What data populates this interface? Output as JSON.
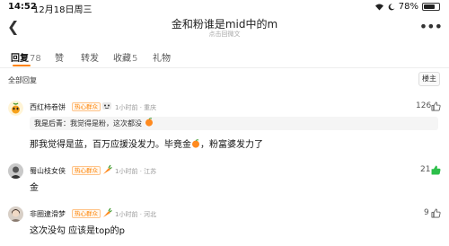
{
  "status_bar": {
    "time": "14:52",
    "date": "12月18日周三",
    "battery": "78%",
    "battery_level": 0.78
  },
  "nav": {
    "title": "金和粉谁是mid中的m",
    "subtitle": "点击回微文"
  },
  "tabs": [
    {
      "label": "回复",
      "count": "78"
    },
    {
      "label": "赞",
      "count": ""
    },
    {
      "label": "转发",
      "count": ""
    },
    {
      "label": "收藏",
      "count": "5"
    },
    {
      "label": "礼物",
      "count": ""
    }
  ],
  "sort": {
    "label": "全部回复",
    "owner_button": "楼主"
  },
  "comments": [
    {
      "username": "西红柿卷饼",
      "badge": "热心群众",
      "time": "1小时前",
      "location": "重庆",
      "likes": "126",
      "liked": false,
      "quote_author": "我是后青：",
      "quote_text": "我觉得是粉，这次都没",
      "text_parts": [
        "那我觉得是蓝，百万应援没发力。毕竟金",
        "，粉富婆发力了"
      ]
    },
    {
      "username": "蜀山枝女侠",
      "badge": "热心群众",
      "time": "1小时前",
      "location": "江苏",
      "likes": "21",
      "liked": true,
      "text": "金"
    },
    {
      "username": "非圈逮滑梦",
      "badge": "热心群众",
      "time": "1小时前",
      "location": "河北",
      "likes": "9",
      "liked": false,
      "text": "这次没勾 应该是top的p"
    }
  ],
  "colors": {
    "accent": "#ff8200",
    "liked": "#2dbf4a",
    "meta": "#999999"
  }
}
